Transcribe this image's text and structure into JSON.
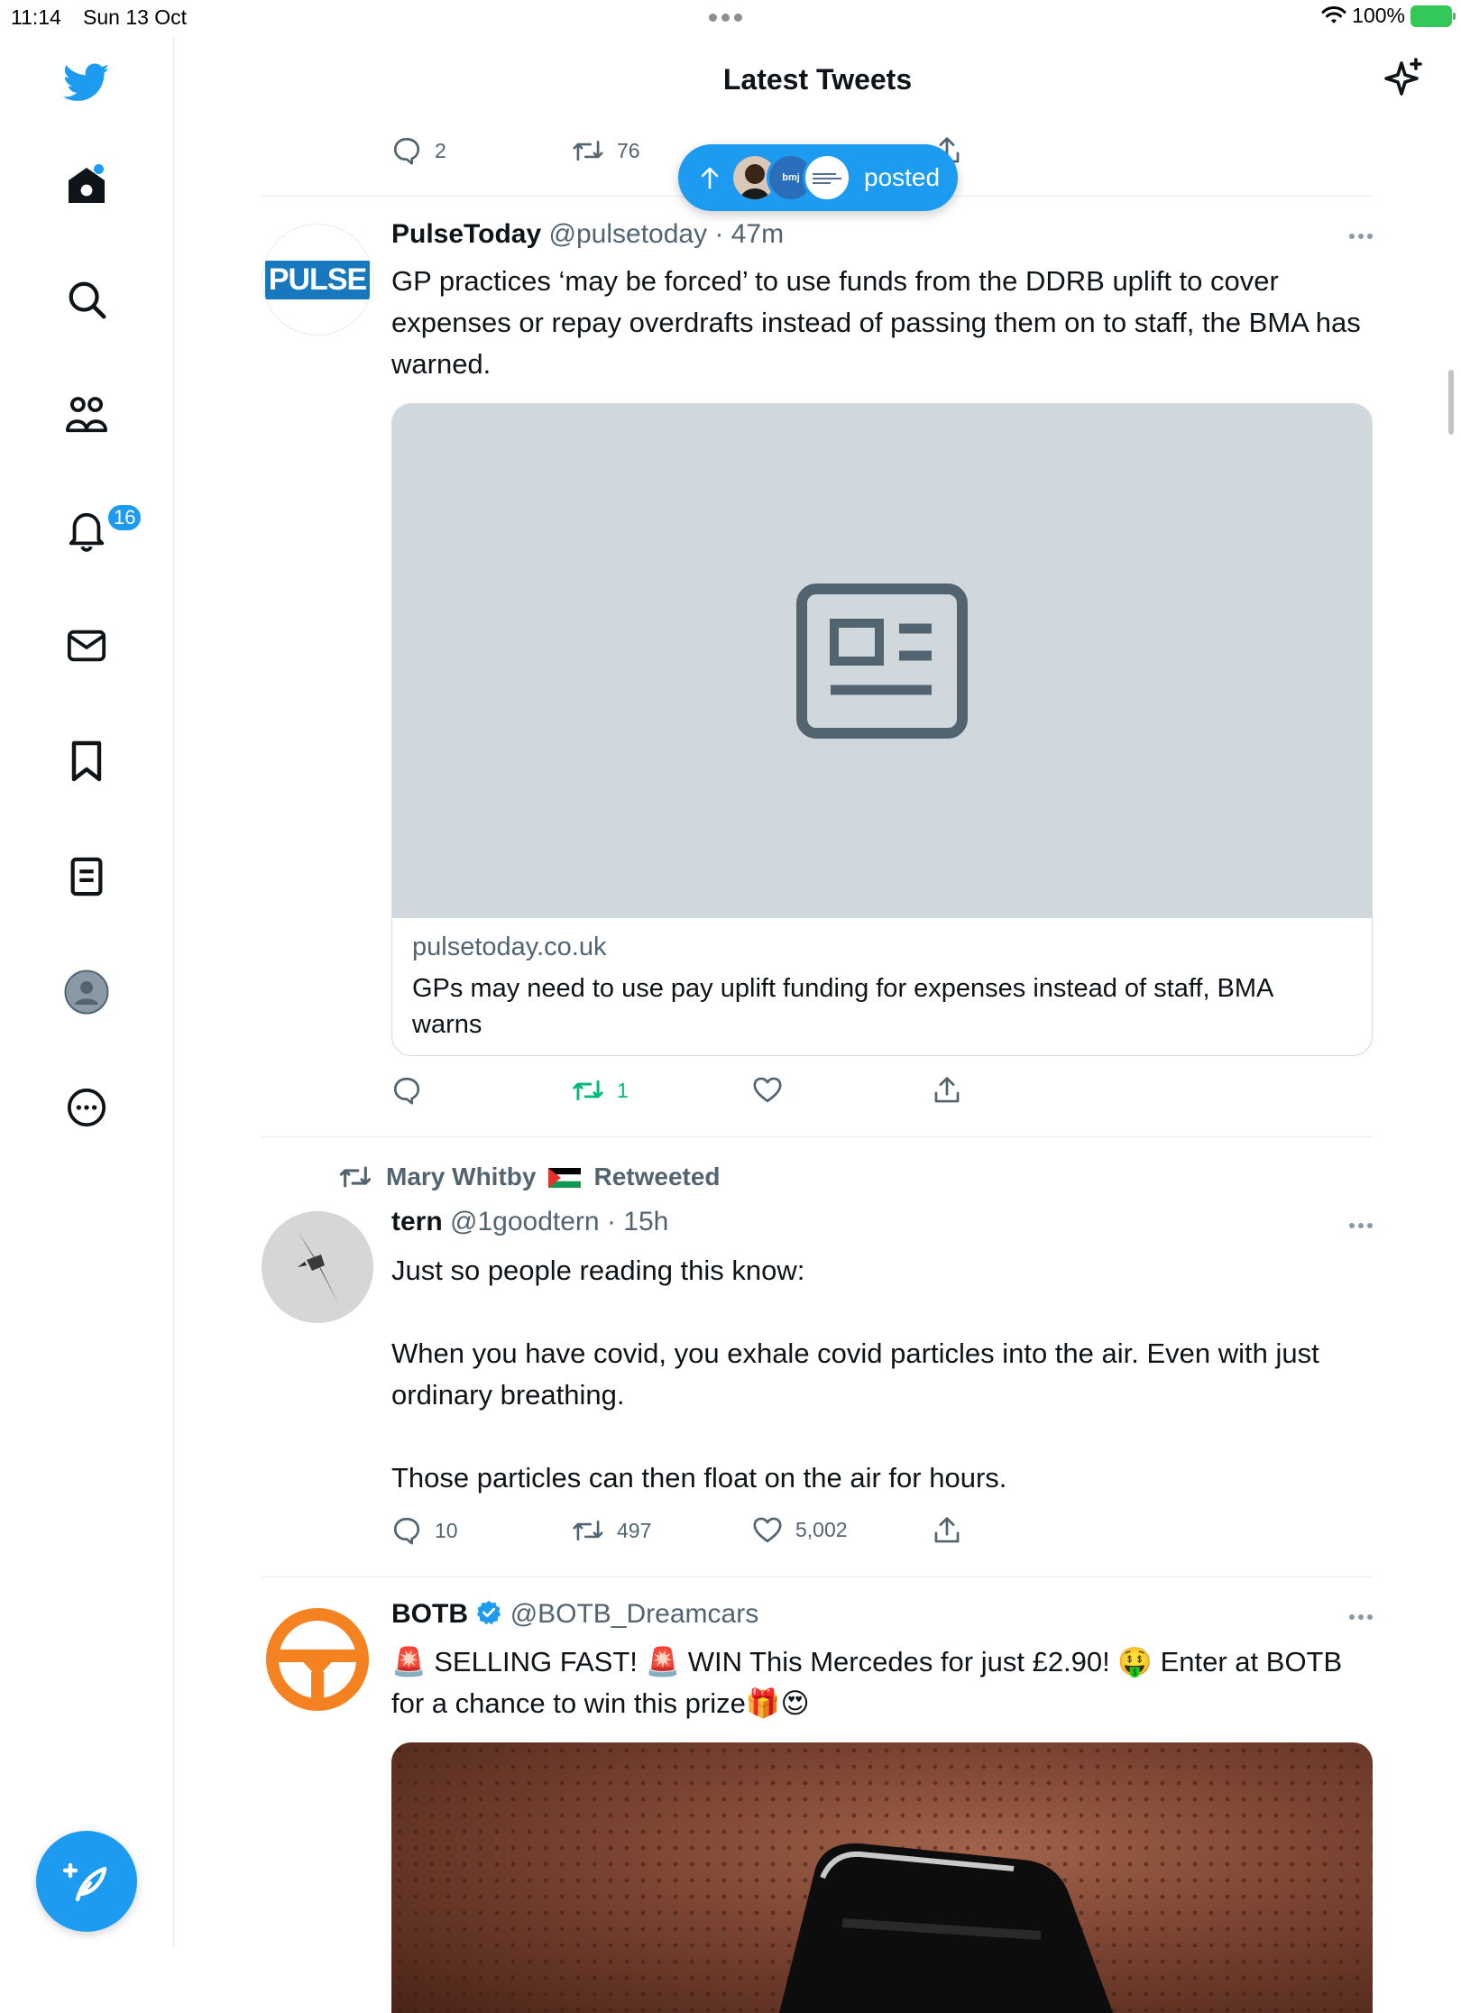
{
  "status_bar": {
    "time": "11:14",
    "date": "Sun 13 Oct",
    "battery": "100%"
  },
  "header": {
    "title": "Latest Tweets"
  },
  "sidebar": {
    "notifications_badge": "16"
  },
  "new_posts_pill": {
    "label": "posted",
    "avatar_text": "bmj"
  },
  "partial_tweet": {
    "reply_count": "2",
    "retweet_count": "76"
  },
  "tweets": [
    {
      "name": "PulseToday",
      "handle": "@pulsetoday",
      "time": "47m",
      "avatar_text": "PULSE",
      "text": "GP practices ‘may be forced’ to use funds from the DDRB uplift to cover expenses or repay overdrafts instead of passing them on to staff, the BMA has warned.",
      "card": {
        "domain": "pulsetoday.co.uk",
        "title": "GPs may need to use pay uplift funding for expenses instead of staff, BMA warns"
      },
      "retweet_count": "1"
    },
    {
      "retweeted_by": "Mary Whitby",
      "retweeted_label": "Retweeted",
      "name": "tern",
      "handle": "@1goodtern",
      "time": "15h",
      "text": "Just so people reading this know:\n\nWhen you have covid, you exhale covid particles into the air. Even with just ordinary breathing.\n\nThose particles can then float on the air for hours.",
      "reply_count": "10",
      "retweet_count": "497",
      "like_count": "5,002"
    },
    {
      "name": "BOTB",
      "handle": "@BOTB_Dreamcars",
      "verified": true,
      "text": "🚨 SELLING FAST! 🚨 WIN This Mercedes for just £2.90! 🤑 Enter at BOTB for a chance to win this prize🎁😍"
    }
  ],
  "colors": {
    "accent": "#1d9bf0",
    "retweet_green": "#00ba7c",
    "muted": "#536471",
    "botb_orange": "#f58220"
  }
}
